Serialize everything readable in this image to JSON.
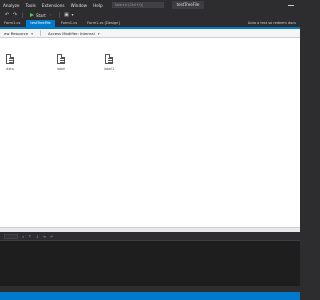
{
  "menu": {
    "items": [
      "Analyze",
      "Tools",
      "Extensions",
      "Window",
      "Help"
    ],
    "search_placeholder": "Search (Ctrl+Q)",
    "solution_name": "testTreeFile"
  },
  "toolbar": {
    "start_label": "Start",
    "icons": [
      "undo-icon",
      "redo-icon",
      "play-icon",
      "save-icon",
      "open-icon"
    ]
  },
  "tabs": [
    {
      "label": "Form1.cs",
      "active": false
    },
    {
      "label": "testTreeFile",
      "active": true
    },
    {
      "label": "Form1.cs",
      "active": false
    },
    {
      "label": "Form1.cs [Design]",
      "active": false
    }
  ],
  "notification": "Auto a test so redeem docs",
  "designer_toolbar": {
    "resources_label": "ew Resource",
    "access_modifier_label": "Access Modifier: Internal"
  },
  "resources": [
    {
      "label": "data"
    },
    {
      "label": "label"
    },
    {
      "label": "label1"
    }
  ],
  "colors": {
    "accent": "#007acc",
    "chrome": "#2d2d30",
    "surface": "#ffffff",
    "output": "#1e1e1e"
  }
}
